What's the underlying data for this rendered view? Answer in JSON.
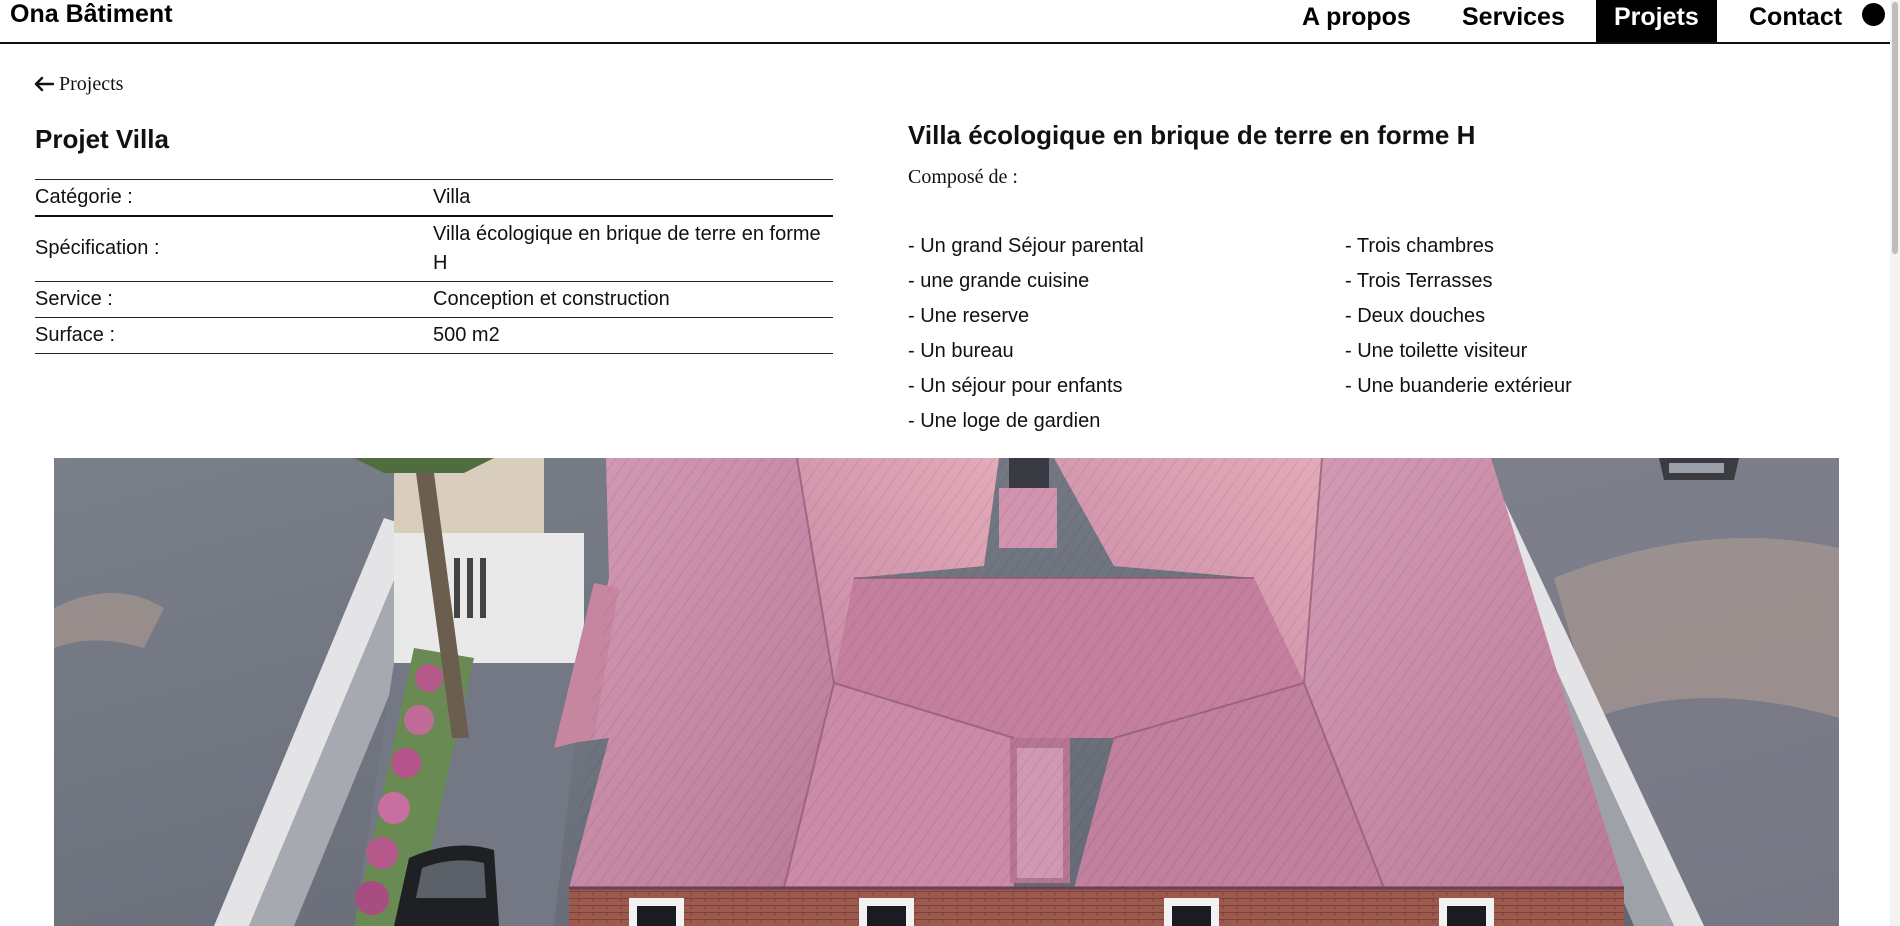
{
  "header": {
    "brand": "Ona Bâtiment",
    "nav": [
      {
        "label": "A propos",
        "active": false
      },
      {
        "label": "Services",
        "active": false
      },
      {
        "label": "Projets",
        "active": true
      },
      {
        "label": "Contact",
        "active": false
      }
    ]
  },
  "back_link": {
    "icon": "arrow-left-icon",
    "label": "Projects"
  },
  "project": {
    "title": "Projet Villa",
    "specs": [
      {
        "label": "Catégorie :",
        "value": "Villa"
      },
      {
        "label": "Spécification :",
        "value": "Villa écologique en brique de terre en forme H"
      },
      {
        "label": "Service :",
        "value": "Conception et construction"
      },
      {
        "label": "Surface :",
        "value": "500 m2"
      }
    ]
  },
  "description": {
    "title_bold": "Villa",
    "title_rest": " écologique en brique de terre en forme H",
    "composed_label": "Composé de :",
    "features_left": [
      "- Un grand Séjour parental",
      "- une grande cuisine",
      "- Une reserve",
      "- Un bureau",
      "- Un séjour pour enfants",
      "- Une loge de gardien"
    ],
    "features_right": [
      "- Trois chambres",
      "- Trois Terrasses",
      "- Deux douches",
      "- Une toilette visiteur",
      "- Une buanderie extérieur"
    ]
  },
  "colors": {
    "roof": "#c98aa6",
    "roof_dark": "#a86b8c",
    "ground": "#6f7480",
    "wall": "#dcdcdc",
    "accent": "#000000"
  }
}
